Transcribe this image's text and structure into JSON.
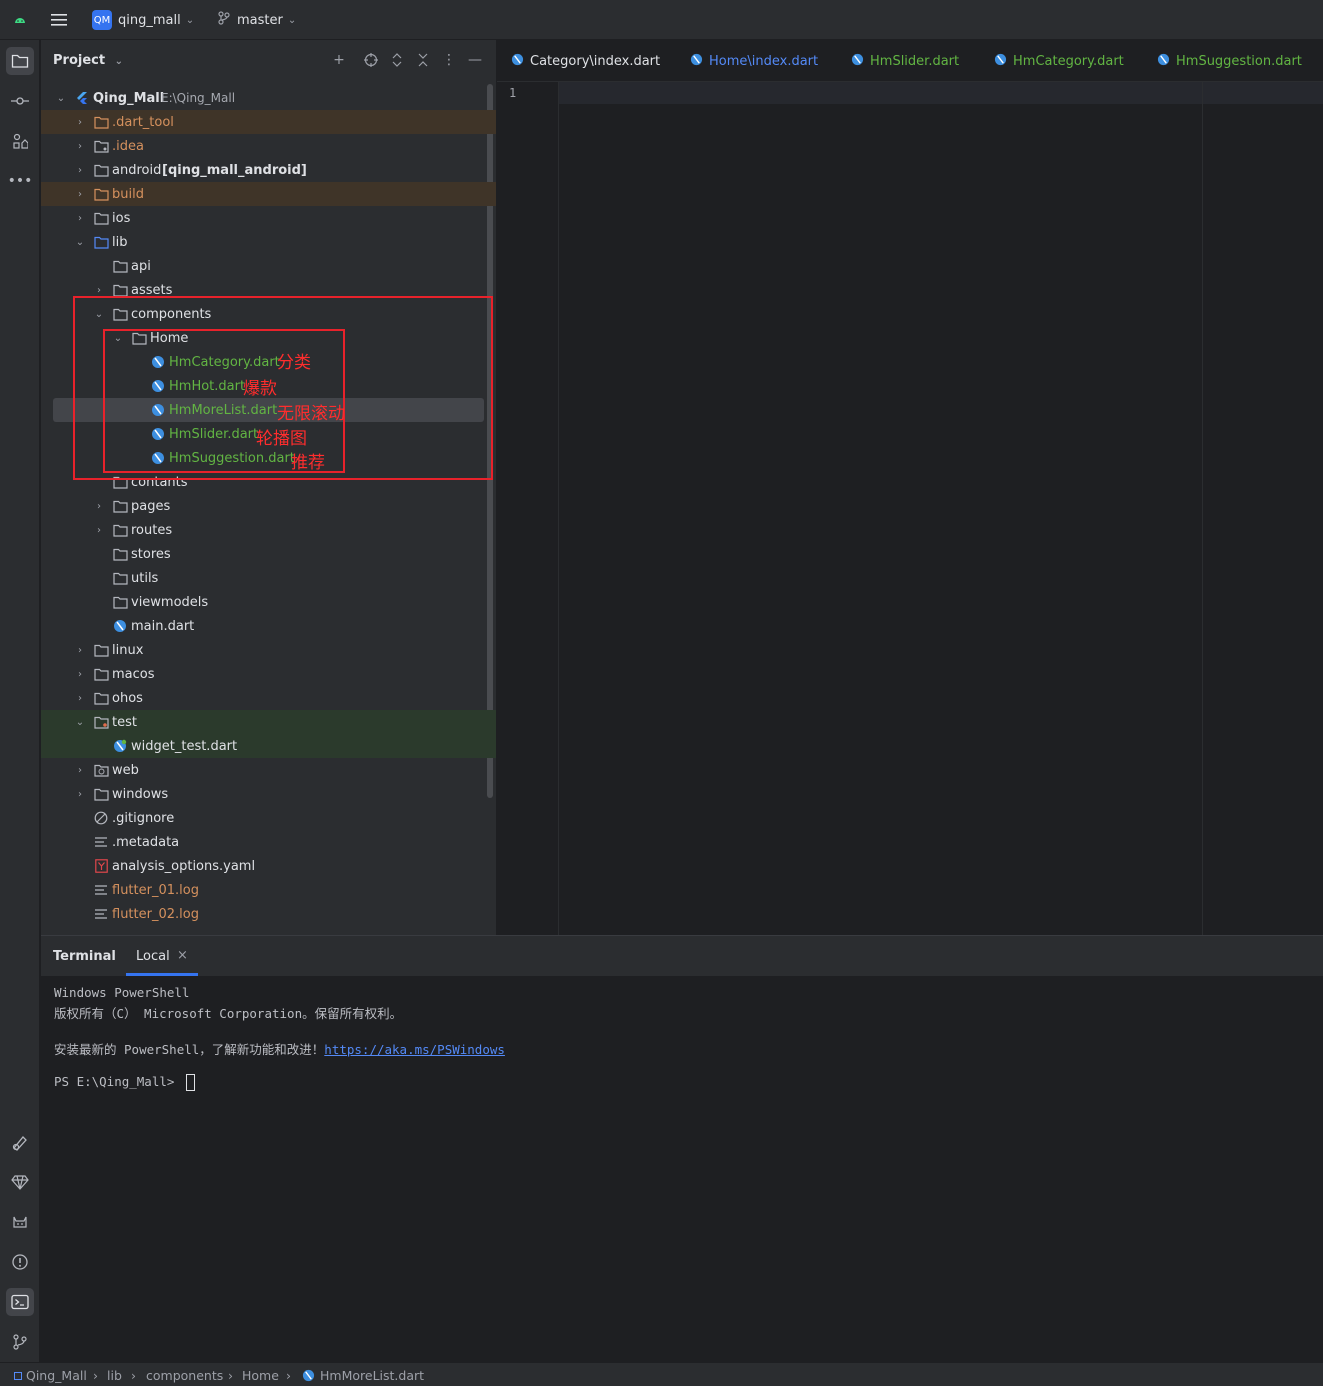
{
  "titlebar": {
    "project_badge": "QM",
    "project_name": "qing_mall",
    "branch": "master"
  },
  "project_panel": {
    "title": "Project",
    "root_name": "Qing_Mall",
    "root_path": "E:\\Qing_Mall",
    "items": [
      {
        "label": ".dart_tool"
      },
      {
        "label": ".idea"
      },
      {
        "label": "android",
        "suffix": "[qing_mall_android]"
      },
      {
        "label": "build"
      },
      {
        "label": "ios"
      },
      {
        "label": "lib"
      },
      {
        "label": "api"
      },
      {
        "label": "assets"
      },
      {
        "label": "components"
      },
      {
        "label": "Home"
      },
      {
        "label": "HmCategory.dart"
      },
      {
        "label": "HmHot.dart"
      },
      {
        "label": "HmMoreList.dart"
      },
      {
        "label": "HmSlider.dart"
      },
      {
        "label": "HmSuggestion.dart"
      },
      {
        "label": "contants"
      },
      {
        "label": "pages"
      },
      {
        "label": "routes"
      },
      {
        "label": "stores"
      },
      {
        "label": "utils"
      },
      {
        "label": "viewmodels"
      },
      {
        "label": "main.dart"
      },
      {
        "label": "linux"
      },
      {
        "label": "macos"
      },
      {
        "label": "ohos"
      },
      {
        "label": "test"
      },
      {
        "label": "widget_test.dart"
      },
      {
        "label": "web"
      },
      {
        "label": "windows"
      },
      {
        "label": ".gitignore"
      },
      {
        "label": ".metadata"
      },
      {
        "label": "analysis_options.yaml"
      },
      {
        "label": "flutter_01.log"
      },
      {
        "label": "flutter_02.log"
      }
    ],
    "annotations": {
      "category": "分类",
      "hot": "爆款",
      "more_list": "无限滚动",
      "slider": "轮播图",
      "suggestion": "推荐"
    }
  },
  "editor": {
    "tabs": [
      {
        "label": "Category\\index.dart"
      },
      {
        "label": "Home\\index.dart"
      },
      {
        "label": "HmSlider.dart"
      },
      {
        "label": "HmCategory.dart"
      },
      {
        "label": "HmSuggestion.dart"
      }
    ],
    "line_number": "1"
  },
  "terminal": {
    "title": "Terminal",
    "tab_local": "Local",
    "tab_close": "×",
    "lines": {
      "l1": "Windows PowerShell",
      "l2": "版权所有（C） Microsoft Corporation。保留所有权利。",
      "l3_prefix": "安装最新的 PowerShell，了解新功能和改进！",
      "l3_link": "https://aka.ms/PSWindows",
      "prompt": "PS E:\\Qing_Mall> "
    }
  },
  "statusbar": {
    "breadcrumbs": [
      "Qing_Mall",
      "lib",
      "components",
      "Home",
      "HmMoreList.dart"
    ]
  },
  "colors": {
    "accent": "#3574f0",
    "annotation_red": "#e8222b",
    "green_file": "#62b543",
    "orange_file": "#d5915e"
  }
}
